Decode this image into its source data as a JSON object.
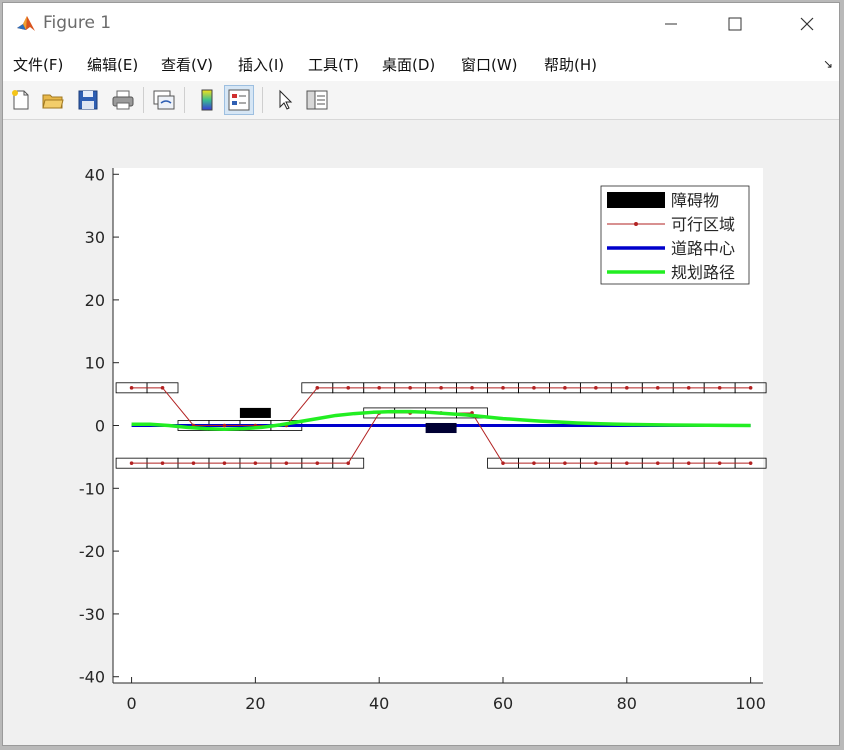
{
  "window": {
    "title": "Figure 1"
  },
  "menubar": {
    "items": [
      {
        "label": "文件(F)"
      },
      {
        "label": "编辑(E)"
      },
      {
        "label": "查看(V)"
      },
      {
        "label": "插入(I)"
      },
      {
        "label": "工具(T)"
      },
      {
        "label": "桌面(D)"
      },
      {
        "label": "窗口(W)"
      },
      {
        "label": "帮助(H)"
      }
    ]
  },
  "toolbar": {
    "buttons": [
      {
        "icon": "new-figure-icon"
      },
      {
        "icon": "open-file-icon"
      },
      {
        "icon": "save-icon"
      },
      {
        "icon": "print-icon"
      },
      {
        "icon": "link-plot-icon"
      },
      {
        "icon": "colorbar-icon"
      },
      {
        "icon": "legend-icon",
        "active": true
      },
      {
        "icon": "pointer-icon"
      },
      {
        "icon": "property-editor-icon"
      }
    ]
  },
  "chart_data": {
    "type": "line",
    "xlim": [
      -3,
      102
    ],
    "ylim": [
      -41,
      41
    ],
    "xticks": [
      0,
      20,
      40,
      60,
      80,
      100
    ],
    "yticks": [
      -40,
      -30,
      -20,
      -10,
      0,
      10,
      20,
      30,
      40
    ],
    "grid": false,
    "legend": {
      "position": "top-right",
      "entries": [
        {
          "label": "障碍物",
          "style": "block",
          "color": "#000000"
        },
        {
          "label": "可行区域",
          "style": "line-dot",
          "color": "#b22222"
        },
        {
          "label": "道路中心",
          "style": "line",
          "color": "#0000cc"
        },
        {
          "label": "规划路径",
          "style": "line",
          "color": "#22ee22"
        }
      ]
    },
    "obstacles": [
      {
        "x": 20,
        "y": 2,
        "w": 5,
        "h": 1.6,
        "color": "#000000"
      },
      {
        "x": 50,
        "y": -0.4,
        "w": 5,
        "h": 1.6,
        "color": "#000033"
      }
    ],
    "feasible_region": {
      "color": "#b22222",
      "upper": {
        "x": [
          0,
          5,
          10,
          15,
          20,
          25,
          30,
          35,
          40,
          45,
          50,
          55,
          60,
          65,
          70,
          75,
          80,
          85,
          90,
          95,
          100
        ],
        "y": [
          6,
          6,
          0,
          0,
          0,
          0,
          6,
          6,
          6,
          6,
          6,
          6,
          6,
          6,
          6,
          6,
          6,
          6,
          6,
          6,
          6
        ]
      },
      "lower": {
        "x": [
          0,
          5,
          10,
          15,
          20,
          25,
          30,
          35,
          40,
          45,
          50,
          55,
          60,
          65,
          70,
          75,
          80,
          85,
          90,
          95,
          100
        ],
        "y": [
          -6,
          -6,
          -6,
          -6,
          -6,
          -6,
          -6,
          -6,
          2,
          2,
          2,
          2,
          -6,
          -6,
          -6,
          -6,
          -6,
          -6,
          -6,
          -6,
          -6
        ]
      }
    },
    "road_center": {
      "color": "#0000cc",
      "x": [
        0,
        100
      ],
      "y": [
        0,
        0
      ]
    },
    "planned_path": {
      "color": "#22ee22",
      "x": [
        0,
        3,
        6,
        9,
        12,
        15,
        18,
        21,
        24,
        27,
        30,
        33,
        36,
        39,
        42,
        45,
        48,
        51,
        54,
        57,
        60,
        63,
        66,
        69,
        72,
        75,
        78,
        81,
        84,
        87,
        90,
        93,
        96,
        100
      ],
      "y": [
        0.2,
        0.2,
        0.0,
        -0.3,
        -0.5,
        -0.6,
        -0.5,
        -0.3,
        0.1,
        0.6,
        1.1,
        1.6,
        1.9,
        2.1,
        2.2,
        2.2,
        2.1,
        1.9,
        1.7,
        1.4,
        1.1,
        0.9,
        0.7,
        0.55,
        0.4,
        0.3,
        0.22,
        0.16,
        0.12,
        0.08,
        0.05,
        0.03,
        0.02,
        0.0
      ]
    }
  }
}
